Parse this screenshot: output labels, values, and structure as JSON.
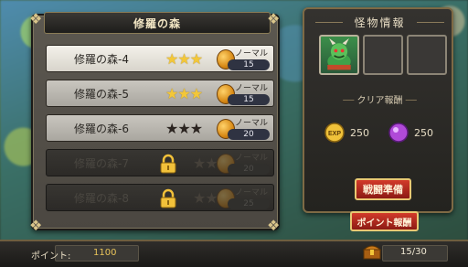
{
  "panel": {
    "title": "修羅の森"
  },
  "stages": [
    {
      "name": "修羅の森-4",
      "stars": 3,
      "difficulty": "ノーマル",
      "count": "15",
      "locked": false,
      "style": "light"
    },
    {
      "name": "修羅の森-5",
      "stars": 3,
      "difficulty": "ノーマル",
      "count": "15",
      "locked": false,
      "style": "mid"
    },
    {
      "name": "修羅の森-6",
      "stars": 0,
      "difficulty": "ノーマル",
      "count": "20",
      "locked": false,
      "style": "mid"
    },
    {
      "name": "修羅の森-7",
      "stars": 0,
      "difficulty": "ノーマル",
      "count": "20",
      "locked": true,
      "style": "locked"
    },
    {
      "name": "修羅の森-8",
      "stars": 0,
      "difficulty": "ノーマル",
      "count": "25",
      "locked": true,
      "style": "locked"
    }
  ],
  "info": {
    "title": "怪物情報",
    "clear_reward_label": "クリア報酬",
    "exp_icon_text": "EXP",
    "exp_reward": "250",
    "orb_reward": "250",
    "prepare_button": "戦闘準備"
  },
  "point_reward_button": "ポイント報酬",
  "footer": {
    "point_label": "ポイント:",
    "point_value": "1100",
    "progress": "15/30"
  },
  "colors": {
    "star_gold": "#f3c739",
    "button_red": "#d23a2a",
    "gold_border": "#e8c873"
  }
}
